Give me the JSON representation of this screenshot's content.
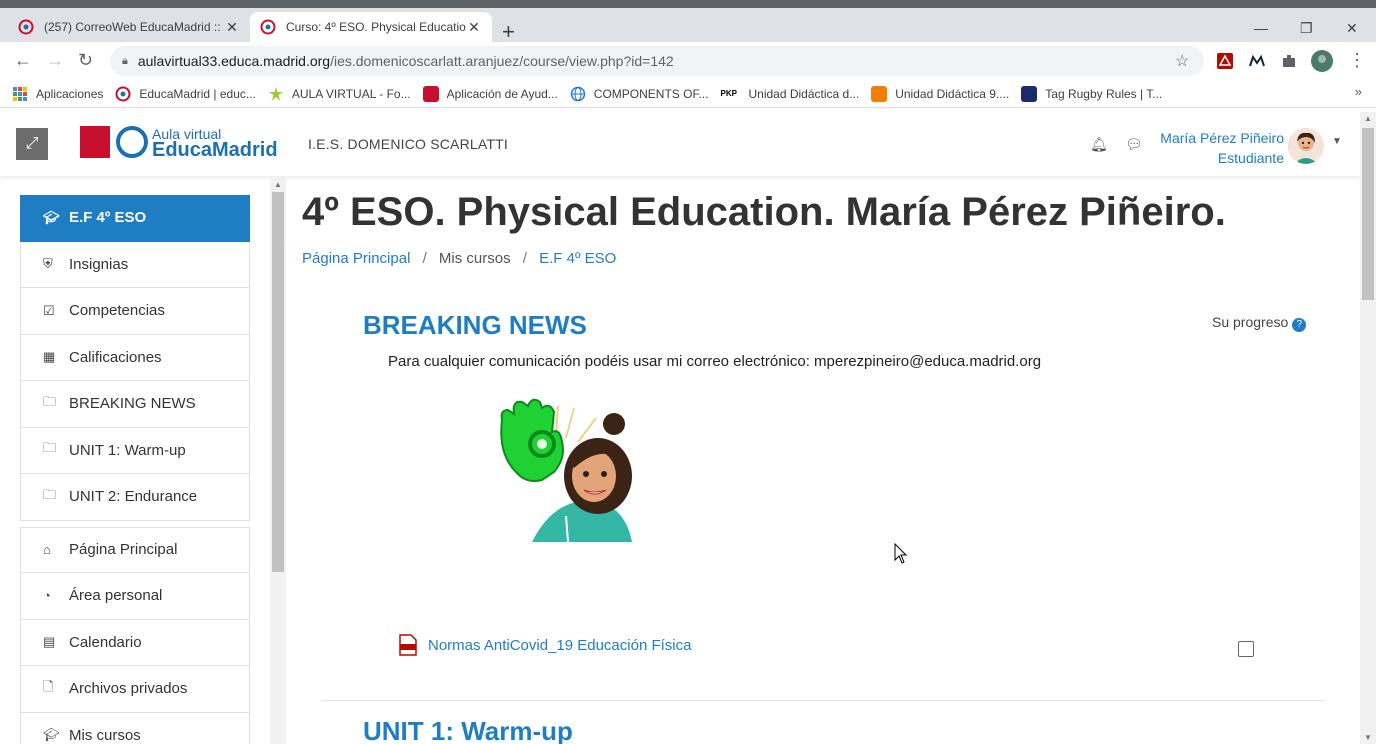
{
  "browser": {
    "tabs": [
      {
        "title": "(257) CorreoWeb EducaMadrid ::",
        "active": false
      },
      {
        "title": "Curso: 4º ESO. Physical Educatio",
        "active": true
      }
    ],
    "url_host": "aulavirtual33.educa.madrid.org",
    "url_path": "/ies.domenicoscarlatt.aranjuez/course/view.php?id=142",
    "bookmarks": [
      {
        "label": "Aplicaciones"
      },
      {
        "label": "EducaMadrid | educ..."
      },
      {
        "label": "AULA VIRTUAL - Fo..."
      },
      {
        "label": "Aplicación de Ayud..."
      },
      {
        "label": "COMPONENTS OF..."
      },
      {
        "label": "Unidad Didáctica d..."
      },
      {
        "label": "Unidad Didáctica 9...."
      },
      {
        "label": "Tag Rugby Rules | T..."
      }
    ],
    "bookmarks_more": "»"
  },
  "header": {
    "logo_line1": "Aula virtual",
    "logo_line2": "EducaMadrid",
    "school": "I.E.S. DOMENICO SCARLATTI",
    "user_name": "María Pérez Piñeiro",
    "user_role": "Estudiante"
  },
  "nav": {
    "course": "E.F 4º ESO",
    "items": [
      {
        "label": "Insignias",
        "icon": "shield-icon"
      },
      {
        "label": "Competencias",
        "icon": "check-square-icon"
      },
      {
        "label": "Calificaciones",
        "icon": "table-icon"
      },
      {
        "label": "BREAKING NEWS",
        "icon": "folder-icon"
      },
      {
        "label": "UNIT 1: Warm-up",
        "icon": "folder-icon"
      },
      {
        "label": "UNIT 2: Endurance",
        "icon": "folder-icon"
      }
    ],
    "items2": [
      {
        "label": "Página Principal",
        "icon": "home-icon"
      },
      {
        "label": "Área personal",
        "icon": "dashboard-icon"
      },
      {
        "label": "Calendario",
        "icon": "calendar-icon"
      },
      {
        "label": "Archivos privados",
        "icon": "file-icon"
      },
      {
        "label": "Mis cursos",
        "icon": "graduation-cap-icon"
      }
    ]
  },
  "main": {
    "title": "4º ESO. Physical Education. María Pérez Piñeiro.",
    "breadcrumb": [
      "Página Principal",
      "Mis cursos",
      "E.F 4º ESO"
    ],
    "progress_label": "Su progreso",
    "section1_title": "BREAKING NEWS",
    "notice": "Para cualquier comunicación podéis usar mi correo electrónico: mperezpineiro@educa.madrid.org",
    "resource_label": "Normas AntiCovid_19 Educación Física",
    "section2_title": "UNIT 1: Warm-up"
  }
}
